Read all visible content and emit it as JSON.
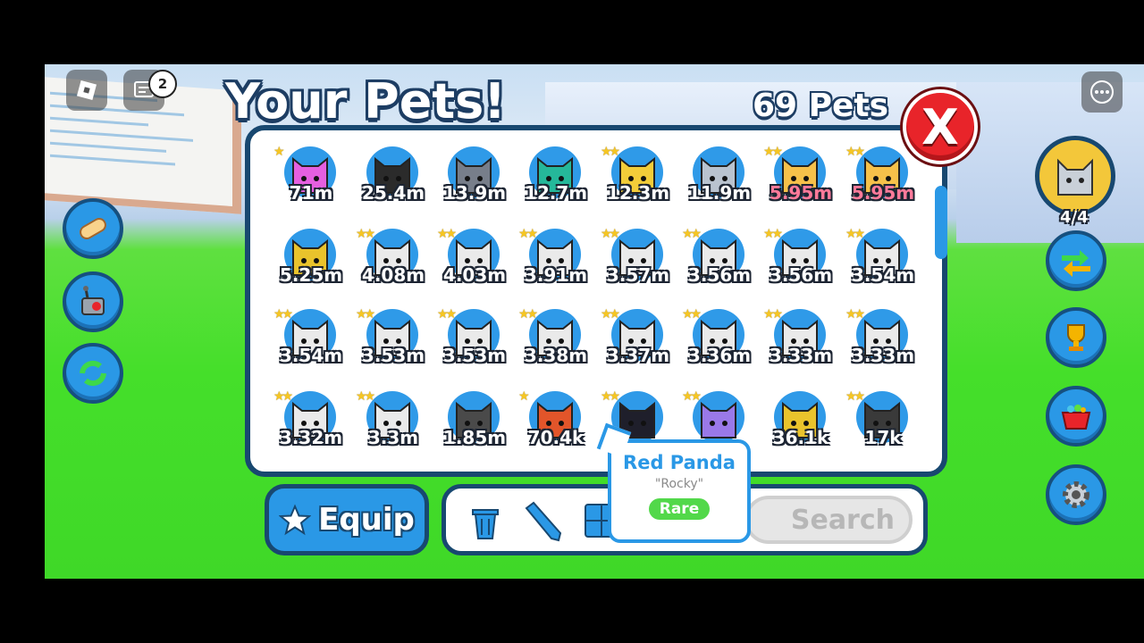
{
  "header": {
    "title": "Your Pets!",
    "pet_count": "69 Pets",
    "close_label": "X"
  },
  "topbar": {
    "chat_badge": "2"
  },
  "equipped_counter": "4/4",
  "pets": [
    {
      "value": "71m",
      "stars": "★",
      "color": "#e55fe0",
      "icon": "pink-crystal-pet"
    },
    {
      "value": "25.4m",
      "stars": "",
      "color": "#2b2b2b",
      "icon": "dark-mech-pet"
    },
    {
      "value": "13.9m",
      "stars": "",
      "color": "#777e8a",
      "icon": "hat-cat-pet"
    },
    {
      "value": "12.7m",
      "stars": "",
      "color": "#25b89a",
      "icon": "teal-robot-pet"
    },
    {
      "value": "12.3m",
      "stars": "★★",
      "color": "#f3cd39",
      "icon": "golden-cat-pet"
    },
    {
      "value": "11.9m",
      "stars": "",
      "color": "#b9c3cf",
      "icon": "silver-mouse-pet"
    },
    {
      "value": "5.95m",
      "stars": "★★",
      "color": "#f6c14a",
      "icon": "rainbow-fox-pet",
      "rainbow": true
    },
    {
      "value": "5.95m",
      "stars": "★★",
      "color": "#f6c14a",
      "icon": "rainbow-fox-pet",
      "rainbow": true
    },
    {
      "value": "5.25m",
      "stars": "",
      "color": "#e9c32c",
      "icon": "golden-chick-pet"
    },
    {
      "value": "4.08m",
      "stars": "★★",
      "color": "#eaeaea",
      "icon": "angel-pet"
    },
    {
      "value": "4.03m",
      "stars": "★★",
      "color": "#eaeaea",
      "icon": "angel-pet"
    },
    {
      "value": "3.91m",
      "stars": "★★",
      "color": "#eaeaea",
      "icon": "angel-pet"
    },
    {
      "value": "3.57m",
      "stars": "★★",
      "color": "#eaeaea",
      "icon": "angel-pet"
    },
    {
      "value": "3.56m",
      "stars": "★★",
      "color": "#eaeaea",
      "icon": "angel-pet"
    },
    {
      "value": "3.56m",
      "stars": "★★",
      "color": "#eaeaea",
      "icon": "angel-pet"
    },
    {
      "value": "3.54m",
      "stars": "★★",
      "color": "#eaeaea",
      "icon": "angel-pet"
    },
    {
      "value": "3.54m",
      "stars": "★★",
      "color": "#eaeaea",
      "icon": "angel-pet"
    },
    {
      "value": "3.53m",
      "stars": "★★",
      "color": "#eaeaea",
      "icon": "angel-pet"
    },
    {
      "value": "3.53m",
      "stars": "★★",
      "color": "#eaeaea",
      "icon": "angel-pet"
    },
    {
      "value": "3.38m",
      "stars": "★★",
      "color": "#eaeaea",
      "icon": "angel-pet"
    },
    {
      "value": "3.37m",
      "stars": "★★",
      "color": "#eaeaea",
      "icon": "angel-pet"
    },
    {
      "value": "3.36m",
      "stars": "★★",
      "color": "#eaeaea",
      "icon": "angel-pet"
    },
    {
      "value": "3.33m",
      "stars": "★★",
      "color": "#eaeaea",
      "icon": "angel-pet"
    },
    {
      "value": "3.33m",
      "stars": "★★",
      "color": "#eaeaea",
      "icon": "angel-pet"
    },
    {
      "value": "3.32m",
      "stars": "★★",
      "color": "#eaeaea",
      "icon": "angel-pet"
    },
    {
      "value": "3.3m",
      "stars": "★★",
      "color": "#eaeaea",
      "icon": "angel-pet"
    },
    {
      "value": "1.85m",
      "stars": "",
      "color": "#4a4a4a",
      "icon": "panda-robot-pet"
    },
    {
      "value": "70.4k",
      "stars": "★",
      "color": "#e2552a",
      "icon": "red-panda-pet"
    },
    {
      "value": "",
      "stars": "★★",
      "color": "#1f1f2b",
      "icon": "black-cat-pet"
    },
    {
      "value": "",
      "stars": "★★",
      "color": "#9a79e8",
      "icon": "purple-dragon-pet"
    },
    {
      "value": "36.1k",
      "stars": "",
      "color": "#e9c32c",
      "icon": "golden-block-pet"
    },
    {
      "value": "17k",
      "stars": "★★",
      "color": "#3a3a3a",
      "icon": "demon-pet"
    }
  ],
  "footer": {
    "equip_label": "Equip",
    "search_placeholder": "Search"
  },
  "tooltip": {
    "name": "Red Panda",
    "nickname": "\"Rocky\"",
    "rarity": "Rare",
    "rarity_color": "#52d84a"
  },
  "colors": {
    "accent": "#2a98e6",
    "border": "#184870",
    "close": "#e8242a"
  }
}
